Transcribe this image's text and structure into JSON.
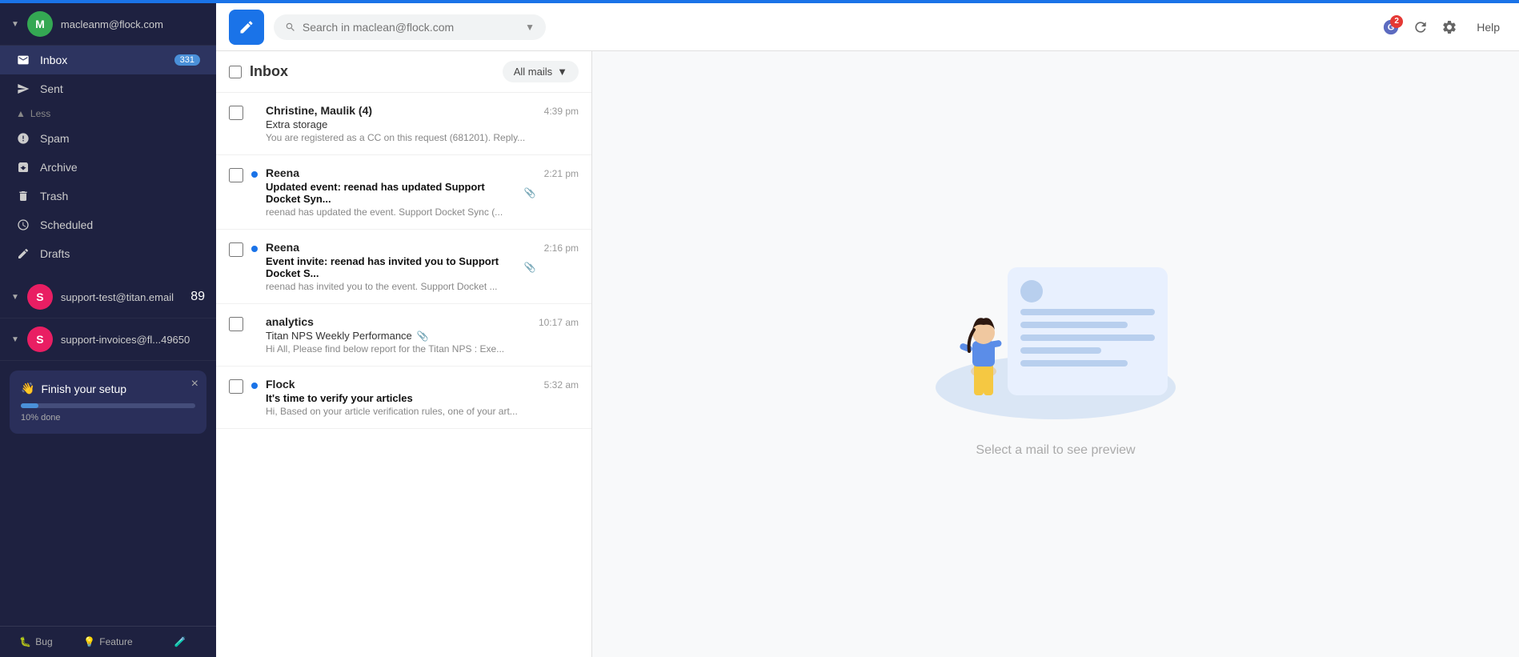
{
  "accent_bar": true,
  "topbar": {
    "search_placeholder": "Search in maclean@flock.com",
    "help_label": "Help"
  },
  "sidebar": {
    "accounts": [
      {
        "id": "maclean",
        "email": "macleanm@flock.com",
        "initial": "M",
        "color": "avatar-m",
        "badge": null
      },
      {
        "id": "support-test",
        "email": "support-test@titan.email",
        "initial": "S",
        "color": "avatar-s",
        "badge": "89"
      },
      {
        "id": "support-invoices",
        "email": "support-invoices@fl...49650",
        "initial": "S",
        "color": "avatar-s2",
        "badge": null
      }
    ],
    "nav_items": [
      {
        "id": "inbox",
        "label": "Inbox",
        "badge": "331",
        "active": true,
        "icon": "inbox-icon"
      },
      {
        "id": "sent",
        "label": "Sent",
        "badge": null,
        "active": false,
        "icon": "sent-icon"
      },
      {
        "id": "less",
        "label": "Less",
        "type": "section",
        "icon": "chevron-up-icon"
      },
      {
        "id": "spam",
        "label": "Spam",
        "badge": null,
        "active": false,
        "icon": "spam-icon"
      },
      {
        "id": "archive",
        "label": "Archive",
        "badge": null,
        "active": false,
        "icon": "archive-icon"
      },
      {
        "id": "trash",
        "label": "Trash",
        "badge": null,
        "active": false,
        "icon": "trash-icon"
      },
      {
        "id": "scheduled",
        "label": "Scheduled",
        "badge": null,
        "active": false,
        "icon": "scheduled-icon"
      },
      {
        "id": "drafts",
        "label": "Drafts",
        "badge": null,
        "active": false,
        "icon": "drafts-icon"
      }
    ],
    "setup": {
      "title": "Finish your setup",
      "progress": 10,
      "progress_label": "10% done"
    },
    "bottom_tabs": [
      {
        "id": "bug",
        "label": "Bug",
        "icon": "bug-icon"
      },
      {
        "id": "feature",
        "label": "Feature",
        "icon": "feature-icon"
      },
      {
        "id": "lab",
        "label": "",
        "icon": "lab-icon"
      }
    ]
  },
  "email_list": {
    "title": "Inbox",
    "filter_label": "All mails",
    "emails": [
      {
        "id": 1,
        "sender": "Christine, Maulik (4)",
        "time": "4:39 pm",
        "subject": "Extra storage",
        "preview": "You are registered as a CC on this request (681201). Reply...",
        "unread": false,
        "has_attachment": false
      },
      {
        "id": 2,
        "sender": "Reena",
        "time": "2:21 pm",
        "subject": "Updated event: reenad has updated Support Docket Syn...",
        "preview": "reenad has updated the event. Support Docket Sync (...",
        "unread": true,
        "has_attachment": true
      },
      {
        "id": 3,
        "sender": "Reena",
        "time": "2:16 pm",
        "subject": "Event invite: reenad has invited you to Support Docket S...",
        "preview": "reenad has invited you to the event. Support Docket ...",
        "unread": true,
        "has_attachment": true
      },
      {
        "id": 4,
        "sender": "analytics",
        "time": "10:17 am",
        "subject": "Titan NPS Weekly Performance",
        "preview": "Hi All, Please find below report for the Titan NPS : Exe...",
        "unread": false,
        "has_attachment": true
      },
      {
        "id": 5,
        "sender": "Flock",
        "time": "5:32 am",
        "subject": "It's time to verify your articles",
        "preview": "Hi, Based on your article verification rules, one of your art...",
        "unread": true,
        "has_attachment": false
      }
    ]
  },
  "preview": {
    "label": "Select a mail to see preview"
  },
  "notifications_count": "2"
}
